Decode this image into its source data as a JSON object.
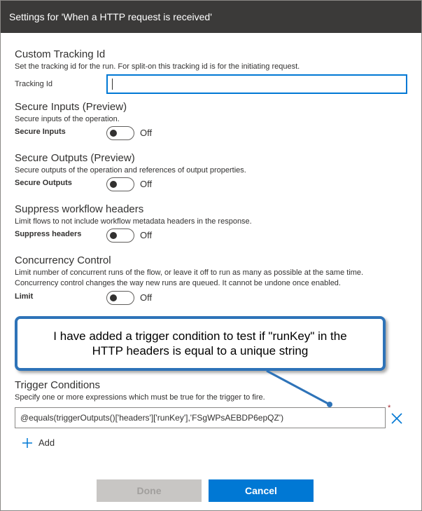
{
  "dialog": {
    "title": "Settings for 'When a HTTP request is received'"
  },
  "tracking": {
    "title": "Custom Tracking Id",
    "description": "Set the tracking id for the run. For split-on this tracking id is for the initiating request.",
    "label": "Tracking Id",
    "value": ""
  },
  "secure_inputs": {
    "title": "Secure Inputs (Preview)",
    "description": "Secure inputs of the operation.",
    "label": "Secure Inputs",
    "state": "Off"
  },
  "secure_outputs": {
    "title": "Secure Outputs (Preview)",
    "description": "Secure outputs of the operation and references of output properties.",
    "label": "Secure Outputs",
    "state": "Off"
  },
  "suppress": {
    "title": "Suppress workflow headers",
    "description": "Limit flows to not include workflow metadata headers in the response.",
    "label": "Suppress headers",
    "state": "Off"
  },
  "concurrency": {
    "title": "Concurrency Control",
    "description_line1": "Limit number of concurrent runs of the flow, or leave it off to run as many as possible at the same time.",
    "description_line2": "Concurrency control changes the way new runs are queued. It cannot be undone once enabled.",
    "label": "Limit",
    "state": "Off"
  },
  "callout": {
    "text": "I have added a trigger condition to test if \"runKey\" in the HTTP headers is equal to a unique string"
  },
  "trigger_conditions": {
    "title": "Trigger Conditions",
    "description": "Specify one or more expressions which must be true for the trigger to fire.",
    "expression": "@equals(triggerOutputs()['headers']['runKey'],'FSgWPsAEBDP6epQZ')",
    "required_mark": "*",
    "add_label": "Add"
  },
  "buttons": {
    "done": "Done",
    "cancel": "Cancel"
  },
  "colors": {
    "accent": "#0078d4",
    "callout_border": "#2e73b8",
    "title_bar": "#3b3a39"
  }
}
